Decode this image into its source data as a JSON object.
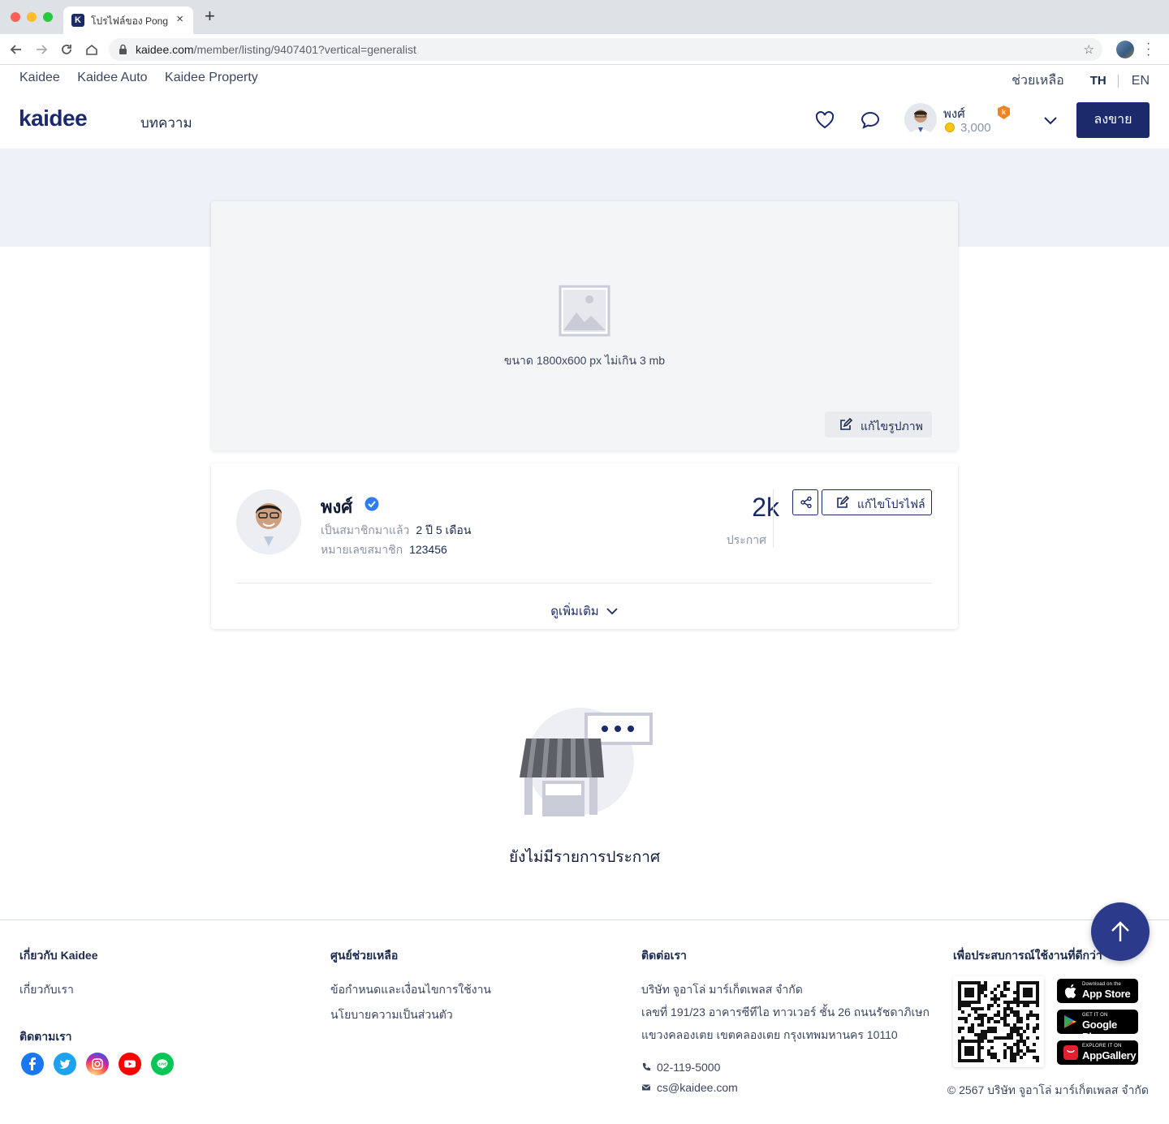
{
  "browser": {
    "tab_title": "โปรไฟล์ของ Pong",
    "url_host": "kaidee.com",
    "url_path": "/member/listing/9407401?vertical=generalist"
  },
  "topnav": {
    "links": [
      "Kaidee",
      "Kaidee Auto",
      "Kaidee Property"
    ],
    "help": "ช่วยเหลือ",
    "lang_th": "TH",
    "lang_en": "EN"
  },
  "header": {
    "logo": "kaidee",
    "article": "บทความ",
    "user_name": "พงศ์",
    "badge_letter": "k",
    "coins": "3,000",
    "sell_label": "ลงขาย"
  },
  "cover": {
    "hint": "ขนาด 1800x600 px ไม่เกิน 3 mb",
    "edit_label": "แก้ไขรูปภาพ"
  },
  "profile": {
    "name": "พงศ์",
    "member_since_label": "เป็นสมาชิกมาแล้ว",
    "member_since_value": "2 ปี 5 เดือน",
    "member_id_label": "หมายเลขสมาชิก",
    "member_id_value": "123456",
    "listing_count": "2k",
    "listing_label": "ประกาศ",
    "edit_profile_label": "แก้ไขโปรไฟล์",
    "see_more_label": "ดูเพิ่มเติม"
  },
  "empty_state": {
    "text": "ยังไม่มีรายการประกาศ"
  },
  "footer": {
    "about_heading": "เกี่ยวกับ Kaidee",
    "about_link": "เกี่ยวกับเรา",
    "follow_heading": "ติดตามเรา",
    "help_heading": "ศูนย์ช่วยเหลือ",
    "help_links": [
      "ข้อกำหนดและเงื่อนไขการใช้งาน",
      "นโยบายความเป็นส่วนตัว"
    ],
    "contact_heading": "ติดต่อเรา",
    "address_lines": [
      "บริษัท จูอาโล่ มาร์เก็ตเพลส จำกัด",
      "เลขที่ 191/23 อาคารซีทีไอ ทาวเวอร์ ชั้น 26 ถนนรัชดาภิเษก",
      "แขวงคลองเตย เขตคลองเตย กรุงเทพมหานคร 10110"
    ],
    "phone": "02-119-5000",
    "email": "cs@kaidee.com",
    "app_heading": "เพื่อประสบการณ์ใช้งานที่ดีกว่า",
    "stores": [
      {
        "small": "Download on the",
        "big": "App Store"
      },
      {
        "small": "GET IT ON",
        "big": "Google Play"
      },
      {
        "small": "EXPLORE IT ON",
        "big": "AppGallery"
      }
    ],
    "copyright": "© 2567 บริษัท จูอาโล่ มาร์เก็ตเพลส จำกัด"
  },
  "colors": {
    "brand_navy": "#1b2a6b",
    "band": "#eef1f8",
    "scroll_top": "#2c3a8c"
  }
}
